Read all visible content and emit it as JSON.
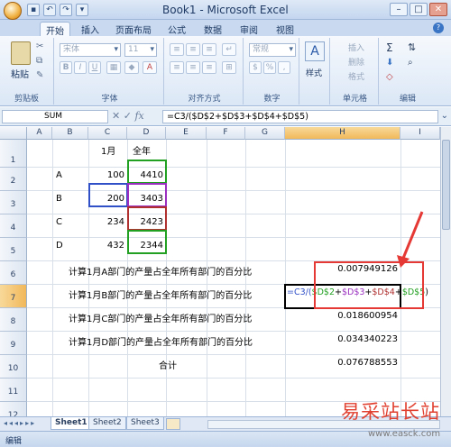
{
  "window": {
    "title": "Book1 - Microsoft Excel",
    "controls": [
      "–",
      "□",
      "✕"
    ]
  },
  "ribbon_tabs": [
    "开始",
    "插入",
    "页面布局",
    "公式",
    "数据",
    "审阅",
    "视图"
  ],
  "ribbon": {
    "clipboard": {
      "paste_label": "粘贴",
      "group_label": "剪贴板"
    },
    "font": {
      "font_name": "宋体",
      "font_size": "11",
      "group_label": "字体"
    },
    "alignment": {
      "group_label": "对齐方式"
    },
    "number": {
      "format": "常规",
      "group_label": "数字"
    },
    "styles": {
      "label": "样式"
    },
    "cells": {
      "insert": "插入",
      "delete": "删除",
      "format": "格式",
      "group_label": "单元格"
    },
    "editing": {
      "sigma": "Σ",
      "group_label": "编辑"
    }
  },
  "formula_bar": {
    "name_box": "SUM",
    "formula": "=C3/($D$2+$D$3+$D$4+$D$5)"
  },
  "columns": [
    "A",
    "B",
    "C",
    "D",
    "E",
    "F",
    "G",
    "H",
    "I"
  ],
  "rows": [
    "1",
    "2",
    "3",
    "4",
    "5",
    "6",
    "7",
    "8",
    "9",
    "10",
    "11",
    "12"
  ],
  "cells": {
    "c1": "1月",
    "d1": "全年",
    "b2": "A",
    "c2": "100",
    "d2": "4410",
    "b3": "B",
    "c3": "200",
    "d3": "3403",
    "b4": "C",
    "c4": "234",
    "d4": "2423",
    "b5": "D",
    "c5": "432",
    "d5": "2344",
    "b6": "计算1月A部门的产量占全年所有部门的百分比",
    "h6": "0.007949126",
    "b7": "计算1月B部门的产量占全年所有部门的百分比",
    "b8": "计算1月C部门的产量占全年所有部门的百分比",
    "h8": "0.018600954",
    "b9": "计算1月D部门的产量占全年所有部门的百分比",
    "h9": "0.034340223",
    "total_label": "合计",
    "h10": "0.076788553"
  },
  "h7_parts": [
    "=C3/(",
    "$D$2",
    "+",
    "$D$3",
    "+",
    "$D$4",
    "+",
    "$D$5",
    ")"
  ],
  "sheet_tabs": [
    "Sheet1",
    "Sheet2",
    "Sheet3"
  ],
  "status": "编辑",
  "watermark": {
    "text": "易采站长站",
    "url": "www.easck.com"
  },
  "colors": {
    "annotation_red": "#e53935",
    "ref_green": "#22a022",
    "ref_purple": "#9b30c0",
    "ref_blue": "#3050c8",
    "ref_darkred": "#b03030"
  }
}
